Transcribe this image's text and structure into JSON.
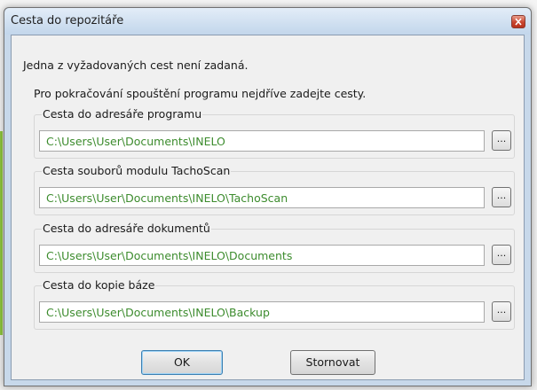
{
  "window": {
    "title": "Cesta do repozitáře"
  },
  "messages": {
    "missing": "Jedna z vyžadovaných cest není zadaná.",
    "instruction": "Pro pokračování spouštění programu nejdříve zadejte cesty."
  },
  "paths": [
    {
      "label": "Cesta do adresáře programu",
      "value": "C:\\Users\\User\\Documents\\INELO",
      "browse": "..."
    },
    {
      "label": "Cesta souborů modulu TachoScan",
      "value": "C:\\Users\\User\\Documents\\INELO\\TachoScan",
      "browse": "..."
    },
    {
      "label": "Cesta do adresáře dokumentů",
      "value": "C:\\Users\\User\\Documents\\INELO\\Documents",
      "browse": "..."
    },
    {
      "label": "Cesta do kopie báze",
      "value": "C:\\Users\\User\\Documents\\INELO\\Backup",
      "browse": "..."
    }
  ],
  "buttons": {
    "ok": "OK",
    "cancel": "Stornovat"
  },
  "colors": {
    "path_text": "#3d8c2e",
    "title_bar": "#cfdff0",
    "close_button": "#c9452f"
  }
}
